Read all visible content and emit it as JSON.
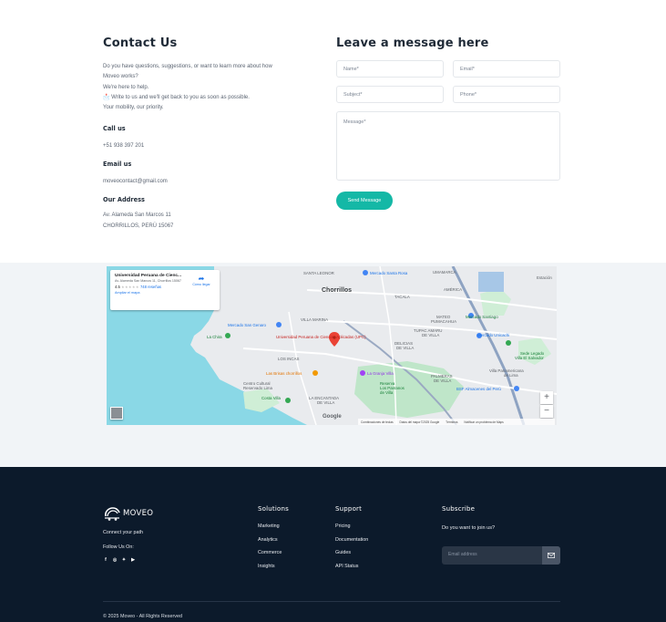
{
  "contact": {
    "title": "Contact Us",
    "intro": [
      "Do you have questions, suggestions, or want to learn more about how",
      "Moveo works?",
      "We're here to help.",
      "📩 Write to us and we'll get back to you as soon as possible.",
      "Your mobility, our priority."
    ],
    "call_heading": "Call us",
    "phone": "+51 938 397 201",
    "email_heading": "Email us",
    "email": "moveocontact@gmail.com",
    "address_heading": "Our Address",
    "address_line1": "Av. Alameda San Marcos 11",
    "address_line2": "CHORRILLOS, PERÚ 15067"
  },
  "form": {
    "title": "Leave a message here",
    "name_placeholder": "Name*",
    "email_placeholder": "Email*",
    "subject_placeholder": "Subject*",
    "phone_placeholder": "Phone*",
    "message_placeholder": "Message*",
    "send_label": "Send Message"
  },
  "map": {
    "place_name": "Universidad Peruana de Cienc...",
    "place_address": "Av. Alameda San Marcos 11, Chorrillos 15067",
    "rating": "4.5",
    "stars": "★★★★★",
    "reviews": "748 reseñas",
    "enlarge_label": "Ampliar el mapa",
    "directions_label": "Cómo llegar",
    "zoom_in": "+",
    "zoom_out": "−",
    "google": "Google",
    "attribution": [
      "Combinaciones de teclas",
      "Datos del mapa ©2025 Google",
      "Términos",
      "Notificar un problema de Maps"
    ],
    "labels": {
      "chorrillos": "Chorrillos",
      "santa_leonor": "SANTA LEONOR",
      "santa_rosa": "Mercado Santa Rosa",
      "umamarca": "UMAMARCA",
      "estacion": "Estación",
      "san_genaro": "Mercado San Genaro",
      "villa_marina": "VILLA MARINA",
      "tacala": "TACALA",
      "america": "AMÉRICA",
      "mateo": "MATEO",
      "pumacahua": "PUMACAHUA",
      "tupac": "TUPAC AMARU",
      "de_villa": "DE VILLA",
      "mercado_santiago": "Mercado Santiago",
      "mercado_unicachi": "Mercado Unicachi",
      "upc": "Universidad Peruana de Ciencias Aplicadas (UPC)",
      "los_incas": "LOS INCAS",
      "delicias": "DELICIAS",
      "de_villa2": "DE VILLA",
      "la_chira": "La Chira",
      "las_brisas": "Las Brisas chorrillos",
      "la_granja": "La Granja Villa",
      "palmeras": "PALMERAS",
      "de_villa3": "DE VILLA",
      "villa_panamericana": "Villa Panamericana",
      "de_lima": "de Lima",
      "sede_legado": "Sede Legado",
      "villa_el_salvador": "Villa El Salvador",
      "centro_cultural": "Centro Cultural",
      "reservado": "Reservado Lima",
      "costa_villa": "Costa Villa",
      "la_encantada": "LA ENCANTADA",
      "de_villa4": "DE VILLA",
      "reserva": "Reserva",
      "los_pantanos": "Los Pantanos",
      "de_villa5": "de Villa",
      "bsf": "BSF Almacenes del Perú"
    }
  },
  "footer": {
    "brand": "MOVEO",
    "tagline": "Connect your path",
    "follow": "Follow Us On:",
    "socials": [
      {
        "icon": "facebook-icon",
        "glyph": "f"
      },
      {
        "icon": "instagram-icon",
        "glyph": "◎"
      },
      {
        "icon": "twitter-icon",
        "glyph": "✦"
      },
      {
        "icon": "youtube-icon",
        "glyph": "▶"
      }
    ],
    "solutions": {
      "heading": "Solutions",
      "items": [
        "Marketing",
        "Analytics",
        "Commerce",
        "Insights"
      ]
    },
    "support": {
      "heading": "Support",
      "items": [
        "Pricing",
        "Documentation",
        "Guides",
        "API Status"
      ]
    },
    "subscribe": {
      "heading": "Subscribe",
      "question": "Do you want to join us?",
      "placeholder": "Email address",
      "button_icon": "mail-icon"
    },
    "copyright": "© 2025 Moveo - All Rights Reserved"
  },
  "colors": {
    "accent": "#14b8a6",
    "footer_bg": "#0c1a2b",
    "map_band": "#f1f4f7",
    "pin": "#ea4335",
    "water": "#8ad8e6"
  }
}
